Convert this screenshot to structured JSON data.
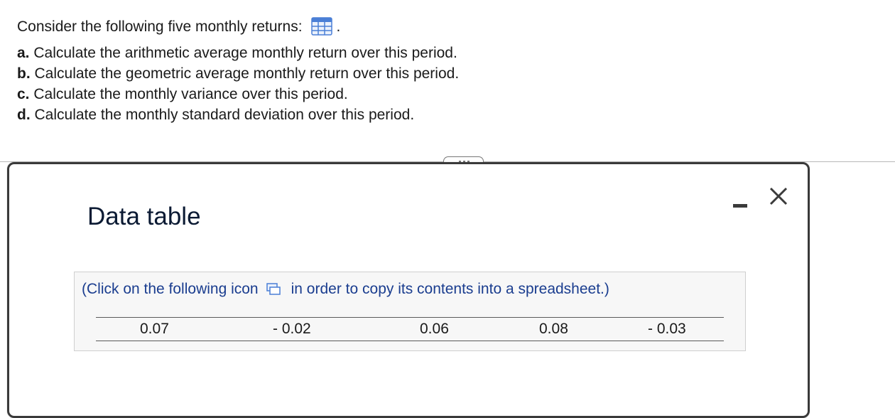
{
  "question": {
    "intro": "Consider the following five monthly returns:",
    "intro_end": ".",
    "parts": [
      {
        "letter": "a.",
        "text": "Calculate the arithmetic average monthly return over this period."
      },
      {
        "letter": "b.",
        "text": "Calculate the geometric average monthly return over this period."
      },
      {
        "letter": "c.",
        "text": "Calculate the monthly variance over this period."
      },
      {
        "letter": "d.",
        "text": "Calculate the monthly standard deviation over this period."
      }
    ]
  },
  "dialog": {
    "title": "Data table",
    "instruction_before": "(Click on the following icon",
    "instruction_after": "in order to copy its contents into a spreadsheet.)",
    "returns": [
      "0.07",
      "- 0.02",
      "0.06",
      "0.08",
      "- 0.03"
    ]
  },
  "colors": {
    "icon_blue": "#4a7fd6",
    "instruction_blue": "#1a3d8f",
    "title": "#0b1a33"
  },
  "icons": {
    "data_table": "grid-icon",
    "copy": "copy-icon",
    "minimize": "minimize-icon",
    "close": "close-icon"
  }
}
